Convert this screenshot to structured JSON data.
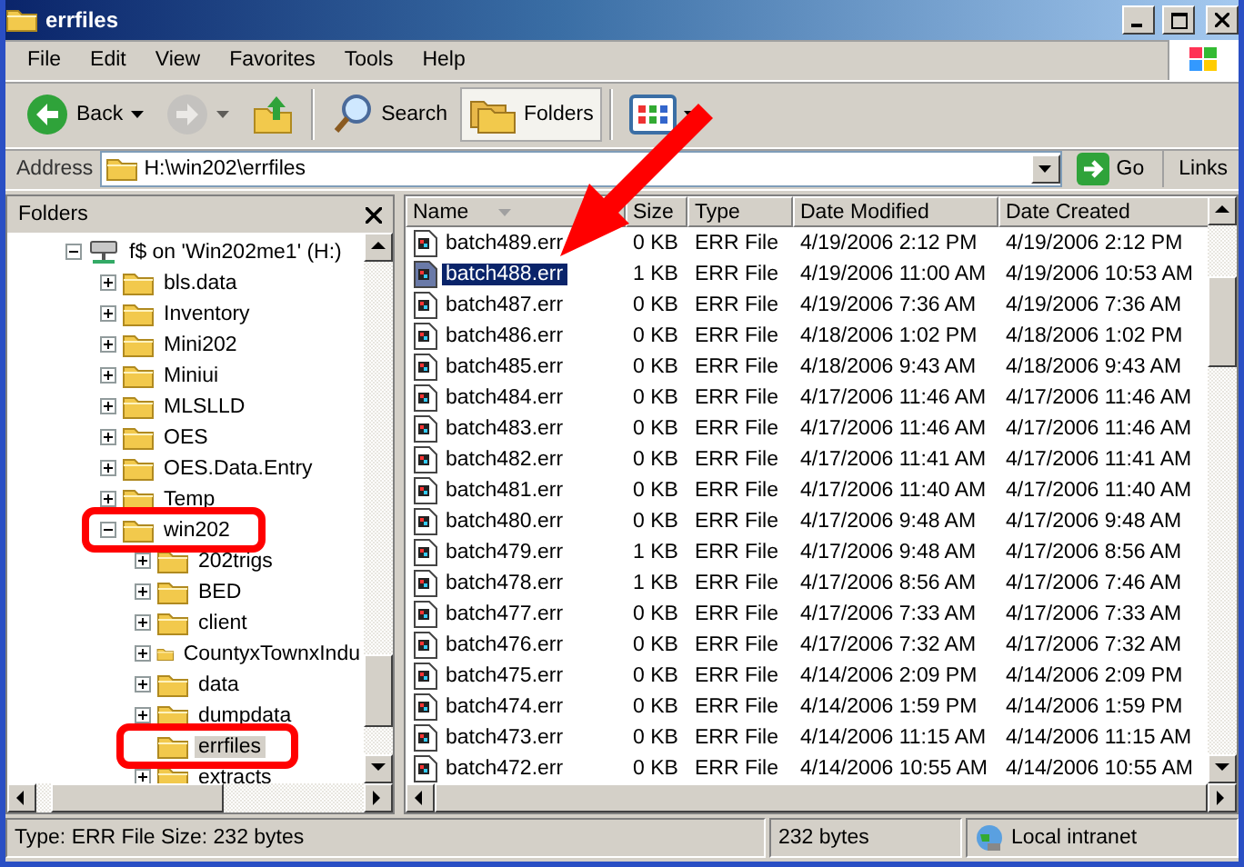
{
  "window": {
    "title": "errfiles"
  },
  "menu": [
    "File",
    "Edit",
    "View",
    "Favorites",
    "Tools",
    "Help"
  ],
  "toolbar": [
    {
      "kind": "back",
      "label": "Back",
      "selected": false,
      "disabled": false
    },
    {
      "kind": "forward",
      "selected": false,
      "disabled": true
    },
    {
      "kind": "up",
      "selected": false,
      "disabled": false
    },
    {
      "kind": "search",
      "label": "Search",
      "selected": false,
      "disabled": false
    },
    {
      "kind": "folders",
      "label": "Folders",
      "selected": true,
      "disabled": false
    },
    {
      "kind": "views",
      "selected": false,
      "disabled": false
    }
  ],
  "address": {
    "label": "Address",
    "value": "H:\\win202\\errfiles",
    "go": "Go",
    "links": "Links"
  },
  "folders_pane": {
    "title": "Folders",
    "tree": [
      {
        "label": "f$ on 'Win202me1' (H:)",
        "kind": "drive",
        "expandable": true,
        "expanded": true,
        "selected": false,
        "annotated": false,
        "children": [
          {
            "label": "bls.data",
            "kind": "folder",
            "expandable": true,
            "expanded": false,
            "selected": false,
            "annotated": false
          },
          {
            "label": "Inventory",
            "kind": "folder",
            "expandable": true,
            "expanded": false,
            "selected": false,
            "annotated": false
          },
          {
            "label": "Mini202",
            "kind": "folder",
            "expandable": true,
            "expanded": false,
            "selected": false,
            "annotated": false
          },
          {
            "label": "Miniui",
            "kind": "folder",
            "expandable": true,
            "expanded": false,
            "selected": false,
            "annotated": false
          },
          {
            "label": "MLSLLD",
            "kind": "folder",
            "expandable": true,
            "expanded": false,
            "selected": false,
            "annotated": false
          },
          {
            "label": "OES",
            "kind": "folder",
            "expandable": true,
            "expanded": false,
            "selected": false,
            "annotated": false
          },
          {
            "label": "OES.Data.Entry",
            "kind": "folder",
            "expandable": true,
            "expanded": false,
            "selected": false,
            "annotated": false
          },
          {
            "label": "Temp",
            "kind": "folder",
            "expandable": true,
            "expanded": false,
            "selected": false,
            "annotated": false
          },
          {
            "label": "win202",
            "kind": "folder",
            "expandable": true,
            "expanded": true,
            "selected": false,
            "annotated": true,
            "children": [
              {
                "label": "202trigs",
                "kind": "folder",
                "expandable": true,
                "expanded": false,
                "selected": false,
                "annotated": false
              },
              {
                "label": "BED",
                "kind": "folder",
                "expandable": true,
                "expanded": false,
                "selected": false,
                "annotated": false
              },
              {
                "label": "client",
                "kind": "folder",
                "expandable": true,
                "expanded": false,
                "selected": false,
                "annotated": false
              },
              {
                "label": "CountyxTownxIndu",
                "kind": "folder",
                "expandable": true,
                "expanded": false,
                "selected": false,
                "annotated": false
              },
              {
                "label": "data",
                "kind": "folder",
                "expandable": true,
                "expanded": false,
                "selected": false,
                "annotated": false
              },
              {
                "label": "dumpdata",
                "kind": "folder",
                "expandable": true,
                "expanded": false,
                "selected": false,
                "annotated": false
              },
              {
                "label": "errfiles",
                "kind": "folder",
                "expandable": false,
                "selected": true,
                "annotated": true
              },
              {
                "label": "extracts",
                "kind": "folder",
                "expandable": true,
                "expanded": false,
                "selected": false,
                "annotated": false
              }
            ]
          }
        ]
      }
    ]
  },
  "file_list": {
    "columns": [
      {
        "label": "Name",
        "sorted": true
      },
      {
        "label": "Size",
        "sorted": false
      },
      {
        "label": "Type",
        "sorted": false
      },
      {
        "label": "Date Modified",
        "sorted": false
      },
      {
        "label": "Date Created",
        "sorted": false
      }
    ],
    "rows": [
      {
        "name": "batch489.err",
        "size": "0 KB",
        "type": "ERR File",
        "modified": "4/19/2006 2:12 PM",
        "created": "4/19/2006 2:12 PM",
        "selected": false
      },
      {
        "name": "batch488.err",
        "size": "1 KB",
        "type": "ERR File",
        "modified": "4/19/2006 11:00 AM",
        "created": "4/19/2006 10:53 AM",
        "selected": true
      },
      {
        "name": "batch487.err",
        "size": "0 KB",
        "type": "ERR File",
        "modified": "4/19/2006 7:36 AM",
        "created": "4/19/2006 7:36 AM",
        "selected": false
      },
      {
        "name": "batch486.err",
        "size": "0 KB",
        "type": "ERR File",
        "modified": "4/18/2006 1:02 PM",
        "created": "4/18/2006 1:02 PM",
        "selected": false
      },
      {
        "name": "batch485.err",
        "size": "0 KB",
        "type": "ERR File",
        "modified": "4/18/2006 9:43 AM",
        "created": "4/18/2006 9:43 AM",
        "selected": false
      },
      {
        "name": "batch484.err",
        "size": "0 KB",
        "type": "ERR File",
        "modified": "4/17/2006 11:46 AM",
        "created": "4/17/2006 11:46 AM",
        "selected": false
      },
      {
        "name": "batch483.err",
        "size": "0 KB",
        "type": "ERR File",
        "modified": "4/17/2006 11:46 AM",
        "created": "4/17/2006 11:46 AM",
        "selected": false
      },
      {
        "name": "batch482.err",
        "size": "0 KB",
        "type": "ERR File",
        "modified": "4/17/2006 11:41 AM",
        "created": "4/17/2006 11:41 AM",
        "selected": false
      },
      {
        "name": "batch481.err",
        "size": "0 KB",
        "type": "ERR File",
        "modified": "4/17/2006 11:40 AM",
        "created": "4/17/2006 11:40 AM",
        "selected": false
      },
      {
        "name": "batch480.err",
        "size": "0 KB",
        "type": "ERR File",
        "modified": "4/17/2006 9:48 AM",
        "created": "4/17/2006 9:48 AM",
        "selected": false
      },
      {
        "name": "batch479.err",
        "size": "1 KB",
        "type": "ERR File",
        "modified": "4/17/2006 9:48 AM",
        "created": "4/17/2006 8:56 AM",
        "selected": false
      },
      {
        "name": "batch478.err",
        "size": "1 KB",
        "type": "ERR File",
        "modified": "4/17/2006 8:56 AM",
        "created": "4/17/2006 7:46 AM",
        "selected": false
      },
      {
        "name": "batch477.err",
        "size": "0 KB",
        "type": "ERR File",
        "modified": "4/17/2006 7:33 AM",
        "created": "4/17/2006 7:33 AM",
        "selected": false
      },
      {
        "name": "batch476.err",
        "size": "0 KB",
        "type": "ERR File",
        "modified": "4/17/2006 7:32 AM",
        "created": "4/17/2006 7:32 AM",
        "selected": false
      },
      {
        "name": "batch475.err",
        "size": "0 KB",
        "type": "ERR File",
        "modified": "4/14/2006 2:09 PM",
        "created": "4/14/2006 2:09 PM",
        "selected": false
      },
      {
        "name": "batch474.err",
        "size": "0 KB",
        "type": "ERR File",
        "modified": "4/14/2006 1:59 PM",
        "created": "4/14/2006 1:59 PM",
        "selected": false
      },
      {
        "name": "batch473.err",
        "size": "0 KB",
        "type": "ERR File",
        "modified": "4/14/2006 11:15 AM",
        "created": "4/14/2006 11:15 AM",
        "selected": false
      },
      {
        "name": "batch472.err",
        "size": "0 KB",
        "type": "ERR File",
        "modified": "4/14/2006 10:55 AM",
        "created": "4/14/2006 10:55 AM",
        "selected": false
      }
    ]
  },
  "status_bar": {
    "text": "Type: ERR File Size: 232 bytes",
    "size": "232 bytes",
    "zone": "Local intranet"
  }
}
